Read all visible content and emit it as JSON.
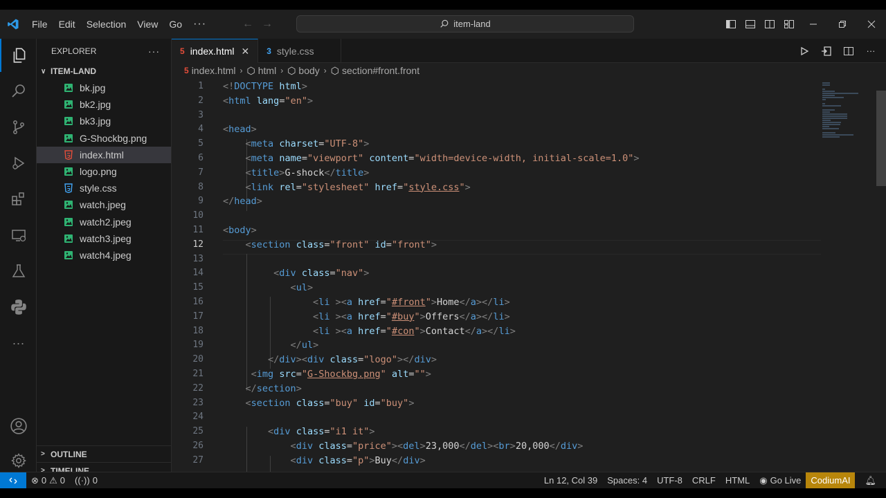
{
  "menu": [
    "File",
    "Edit",
    "Selection",
    "View",
    "Go",
    "···"
  ],
  "search": {
    "text": "item-land"
  },
  "sidebar": {
    "title": "EXPLORER",
    "folder": "ITEM-LAND",
    "files": [
      {
        "name": "bk.jpg",
        "type": "image",
        "selected": false
      },
      {
        "name": "bk2.jpg",
        "type": "image",
        "selected": false
      },
      {
        "name": "bk3.jpg",
        "type": "image",
        "selected": false
      },
      {
        "name": "G-Shockbg.png",
        "type": "image",
        "selected": false
      },
      {
        "name": "index.html",
        "type": "html",
        "selected": true
      },
      {
        "name": "logo.png",
        "type": "image",
        "selected": false
      },
      {
        "name": "style.css",
        "type": "css",
        "selected": false
      },
      {
        "name": "watch.jpeg",
        "type": "image",
        "selected": false
      },
      {
        "name": "watch2.jpeg",
        "type": "image",
        "selected": false
      },
      {
        "name": "watch3.jpeg",
        "type": "image",
        "selected": false
      },
      {
        "name": "watch4.jpeg",
        "type": "image",
        "selected": false
      }
    ],
    "outline": "OUTLINE",
    "timeline": "TIMELINE"
  },
  "tabs": [
    {
      "label": "index.html",
      "type": "html",
      "active": true
    },
    {
      "label": "style.css",
      "type": "css",
      "active": false
    }
  ],
  "breadcrumb": [
    "index.html",
    "html",
    "body",
    "section#front.front"
  ],
  "editor": {
    "current_line": 12,
    "lines": [
      [
        [
          "t",
          "<!"
        ],
        [
          "n",
          "DOCTYPE"
        ],
        [
          "x",
          " "
        ],
        [
          "a",
          "html"
        ],
        [
          "t",
          ">"
        ]
      ],
      [
        [
          "t",
          "<"
        ],
        [
          "n",
          "html"
        ],
        [
          "x",
          " "
        ],
        [
          "a",
          "lang"
        ],
        [
          "x",
          "="
        ],
        [
          "s",
          "\"en\""
        ],
        [
          "t",
          ">"
        ]
      ],
      [],
      [
        [
          "t",
          "<"
        ],
        [
          "n",
          "head"
        ],
        [
          "t",
          ">"
        ]
      ],
      [
        [
          "x",
          "    "
        ],
        [
          "t",
          "<"
        ],
        [
          "n",
          "meta"
        ],
        [
          "x",
          " "
        ],
        [
          "a",
          "charset"
        ],
        [
          "x",
          "="
        ],
        [
          "s",
          "\"UTF-8\""
        ],
        [
          "t",
          ">"
        ]
      ],
      [
        [
          "x",
          "    "
        ],
        [
          "t",
          "<"
        ],
        [
          "n",
          "meta"
        ],
        [
          "x",
          " "
        ],
        [
          "a",
          "name"
        ],
        [
          "x",
          "="
        ],
        [
          "s",
          "\"viewport\""
        ],
        [
          "x",
          " "
        ],
        [
          "a",
          "content"
        ],
        [
          "x",
          "="
        ],
        [
          "s",
          "\"width=device-width, initial-scale=1.0\""
        ],
        [
          "t",
          ">"
        ]
      ],
      [
        [
          "x",
          "    "
        ],
        [
          "t",
          "<"
        ],
        [
          "n",
          "title"
        ],
        [
          "t",
          ">"
        ],
        [
          "x",
          "G-shock"
        ],
        [
          "t",
          "</"
        ],
        [
          "n",
          "title"
        ],
        [
          "t",
          ">"
        ]
      ],
      [
        [
          "x",
          "    "
        ],
        [
          "t",
          "<"
        ],
        [
          "n",
          "link"
        ],
        [
          "x",
          " "
        ],
        [
          "a",
          "rel"
        ],
        [
          "x",
          "="
        ],
        [
          "s",
          "\"stylesheet\""
        ],
        [
          "x",
          " "
        ],
        [
          "a",
          "href"
        ],
        [
          "x",
          "="
        ],
        [
          "s",
          "\""
        ],
        [
          "u",
          "style.css"
        ],
        [
          "s",
          "\""
        ],
        [
          "t",
          ">"
        ]
      ],
      [
        [
          "t",
          "</"
        ],
        [
          "n",
          "head"
        ],
        [
          "t",
          ">"
        ]
      ],
      [],
      [
        [
          "t",
          "<"
        ],
        [
          "n",
          "body"
        ],
        [
          "t",
          ">"
        ]
      ],
      [
        [
          "x",
          "    "
        ],
        [
          "t",
          "<"
        ],
        [
          "n",
          "section"
        ],
        [
          "x",
          " "
        ],
        [
          "a",
          "class"
        ],
        [
          "x",
          "="
        ],
        [
          "s",
          "\"front\""
        ],
        [
          "x",
          " "
        ],
        [
          "a",
          "id"
        ],
        [
          "x",
          "="
        ],
        [
          "s",
          "\"front\""
        ],
        [
          "t",
          ">"
        ]
      ],
      [],
      [
        [
          "x",
          "         "
        ],
        [
          "t",
          "<"
        ],
        [
          "n",
          "div"
        ],
        [
          "x",
          " "
        ],
        [
          "a",
          "class"
        ],
        [
          "x",
          "="
        ],
        [
          "s",
          "\"nav\""
        ],
        [
          "t",
          ">"
        ]
      ],
      [
        [
          "x",
          "            "
        ],
        [
          "t",
          "<"
        ],
        [
          "n",
          "ul"
        ],
        [
          "t",
          ">"
        ]
      ],
      [
        [
          "x",
          "                "
        ],
        [
          "t",
          "<"
        ],
        [
          "n",
          "li"
        ],
        [
          "x",
          " "
        ],
        [
          "t",
          "><"
        ],
        [
          "n",
          "a"
        ],
        [
          "x",
          " "
        ],
        [
          "a",
          "href"
        ],
        [
          "x",
          "="
        ],
        [
          "s",
          "\""
        ],
        [
          "u",
          "#front"
        ],
        [
          "s",
          "\""
        ],
        [
          "t",
          ">"
        ],
        [
          "x",
          "Home"
        ],
        [
          "t",
          "</"
        ],
        [
          "n",
          "a"
        ],
        [
          "t",
          "></"
        ],
        [
          "n",
          "li"
        ],
        [
          "t",
          ">"
        ]
      ],
      [
        [
          "x",
          "                "
        ],
        [
          "t",
          "<"
        ],
        [
          "n",
          "li"
        ],
        [
          "x",
          " "
        ],
        [
          "t",
          "><"
        ],
        [
          "n",
          "a"
        ],
        [
          "x",
          " "
        ],
        [
          "a",
          "href"
        ],
        [
          "x",
          "="
        ],
        [
          "s",
          "\""
        ],
        [
          "u",
          "#buy"
        ],
        [
          "s",
          "\""
        ],
        [
          "t",
          ">"
        ],
        [
          "x",
          "Offers"
        ],
        [
          "t",
          "</"
        ],
        [
          "n",
          "a"
        ],
        [
          "t",
          "></"
        ],
        [
          "n",
          "li"
        ],
        [
          "t",
          ">"
        ]
      ],
      [
        [
          "x",
          "                "
        ],
        [
          "t",
          "<"
        ],
        [
          "n",
          "li"
        ],
        [
          "x",
          " "
        ],
        [
          "t",
          "><"
        ],
        [
          "n",
          "a"
        ],
        [
          "x",
          " "
        ],
        [
          "a",
          "href"
        ],
        [
          "x",
          "="
        ],
        [
          "s",
          "\""
        ],
        [
          "u",
          "#con"
        ],
        [
          "s",
          "\""
        ],
        [
          "t",
          ">"
        ],
        [
          "x",
          "Contact"
        ],
        [
          "t",
          "</"
        ],
        [
          "n",
          "a"
        ],
        [
          "t",
          "></"
        ],
        [
          "n",
          "li"
        ],
        [
          "t",
          ">"
        ]
      ],
      [
        [
          "x",
          "            "
        ],
        [
          "t",
          "</"
        ],
        [
          "n",
          "ul"
        ],
        [
          "t",
          ">"
        ]
      ],
      [
        [
          "x",
          "        "
        ],
        [
          "t",
          "</"
        ],
        [
          "n",
          "div"
        ],
        [
          "t",
          "><"
        ],
        [
          "n",
          "div"
        ],
        [
          "x",
          " "
        ],
        [
          "a",
          "class"
        ],
        [
          "x",
          "="
        ],
        [
          "s",
          "\"logo\""
        ],
        [
          "t",
          "></"
        ],
        [
          "n",
          "div"
        ],
        [
          "t",
          ">"
        ]
      ],
      [
        [
          "x",
          "     "
        ],
        [
          "t",
          "<"
        ],
        [
          "n",
          "img"
        ],
        [
          "x",
          " "
        ],
        [
          "a",
          "src"
        ],
        [
          "x",
          "="
        ],
        [
          "s",
          "\""
        ],
        [
          "u",
          "G-Shockbg.png"
        ],
        [
          "s",
          "\""
        ],
        [
          "x",
          " "
        ],
        [
          "a",
          "alt"
        ],
        [
          "x",
          "="
        ],
        [
          "s",
          "\"\""
        ],
        [
          "t",
          ">"
        ]
      ],
      [
        [
          "x",
          "    "
        ],
        [
          "t",
          "</"
        ],
        [
          "n",
          "section"
        ],
        [
          "t",
          ">"
        ]
      ],
      [
        [
          "x",
          "    "
        ],
        [
          "t",
          "<"
        ],
        [
          "n",
          "section"
        ],
        [
          "x",
          " "
        ],
        [
          "a",
          "class"
        ],
        [
          "x",
          "="
        ],
        [
          "s",
          "\"buy\""
        ],
        [
          "x",
          " "
        ],
        [
          "a",
          "id"
        ],
        [
          "x",
          "="
        ],
        [
          "s",
          "\"buy\""
        ],
        [
          "t",
          ">"
        ]
      ],
      [],
      [
        [
          "x",
          "        "
        ],
        [
          "t",
          "<"
        ],
        [
          "n",
          "div"
        ],
        [
          "x",
          " "
        ],
        [
          "a",
          "class"
        ],
        [
          "x",
          "="
        ],
        [
          "s",
          "\"i1 it\""
        ],
        [
          "t",
          ">"
        ]
      ],
      [
        [
          "x",
          "            "
        ],
        [
          "t",
          "<"
        ],
        [
          "n",
          "div"
        ],
        [
          "x",
          " "
        ],
        [
          "a",
          "class"
        ],
        [
          "x",
          "="
        ],
        [
          "s",
          "\"price\""
        ],
        [
          "t",
          "><"
        ],
        [
          "n",
          "del"
        ],
        [
          "t",
          ">"
        ],
        [
          "x",
          "23,000"
        ],
        [
          "t",
          "</"
        ],
        [
          "n",
          "del"
        ],
        [
          "t",
          "><"
        ],
        [
          "n",
          "br"
        ],
        [
          "t",
          ">"
        ],
        [
          "x",
          "20,000"
        ],
        [
          "t",
          "</"
        ],
        [
          "n",
          "div"
        ],
        [
          "t",
          ">"
        ]
      ],
      [
        [
          "x",
          "            "
        ],
        [
          "t",
          "<"
        ],
        [
          "n",
          "div"
        ],
        [
          "x",
          " "
        ],
        [
          "a",
          "class"
        ],
        [
          "x",
          "="
        ],
        [
          "s",
          "\"p\""
        ],
        [
          "t",
          ">"
        ],
        [
          "x",
          "Buy"
        ],
        [
          "t",
          "</"
        ],
        [
          "n",
          "div"
        ],
        [
          "t",
          ">"
        ]
      ]
    ]
  },
  "status": {
    "errors": "0",
    "warnings": "0",
    "ports": "0",
    "position": "Ln 12, Col 39",
    "spaces": "Spaces: 4",
    "encoding": "UTF-8",
    "eol": "CRLF",
    "language": "HTML",
    "golive": "Go Live",
    "codium": "CodiumAI"
  },
  "colors": {
    "accent": "#0078d4",
    "image_icon": "#2fb372",
    "html_icon": "#e44d3a",
    "css_icon": "#42a5f5",
    "codium_bg": "#b8860b"
  }
}
